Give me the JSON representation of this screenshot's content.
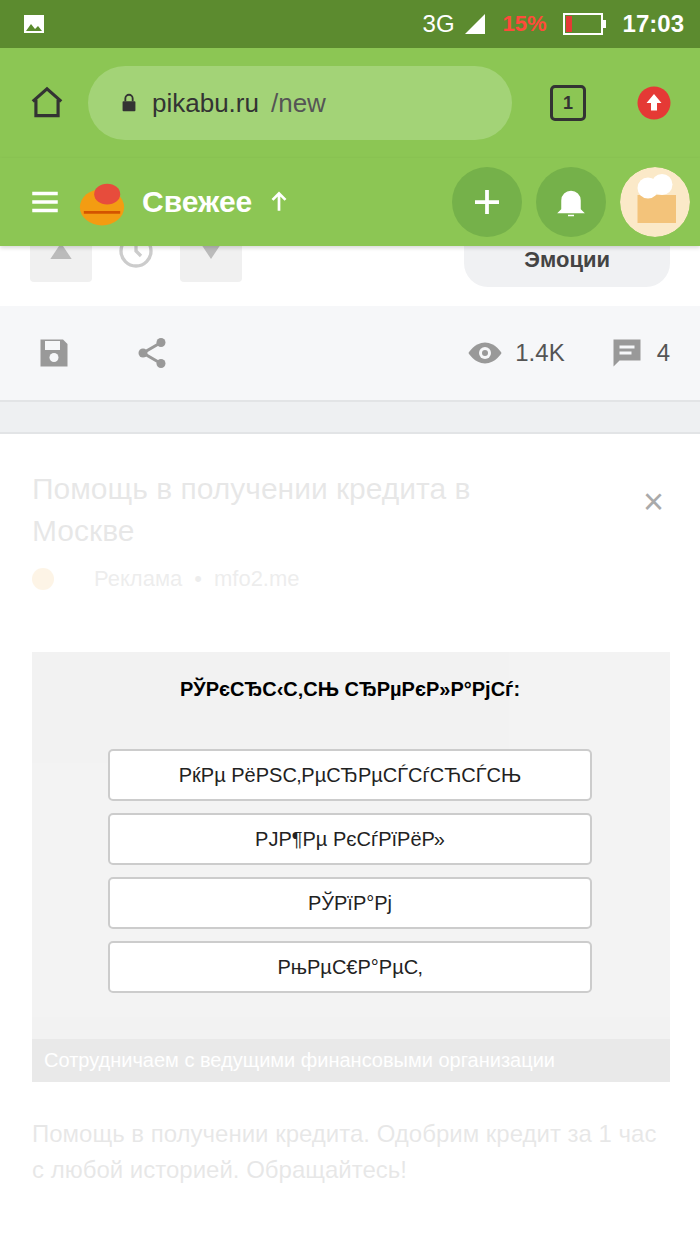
{
  "status_bar": {
    "network": "3G",
    "battery": "15%",
    "time": "17:03"
  },
  "browser": {
    "url_host": "pikabu.ru",
    "url_path": "/new",
    "tab_count": "1"
  },
  "header": {
    "title": "Свежее"
  },
  "post_bar": {
    "emotions": "Эмоции",
    "views": "1.4K",
    "comments": "4"
  },
  "ad": {
    "title": "Помощь в получении кредита в Москве",
    "label": "Реклама",
    "domain": "mfo2.me",
    "close": "×",
    "caption": "Сотрудничаем с ведущими финансовыми организации",
    "body": "Помощь в получении кредита. Одобрим кредит за 1 час с любой историей. Обращайтесь!"
  },
  "hide_menu": {
    "title": "РЎРєСЂС‹С‚СЊ СЂРµРєР»Р°РјСѓ:",
    "options": [
      "РќРµ РёРЅС‚РµСЂРµСЃСѓСЋСЃСЊ",
      "РЈР¶Рµ РєСѓРїРёР»",
      "РЎРїР°Рј",
      "РњРµС€Р°РµС‚"
    ]
  }
}
